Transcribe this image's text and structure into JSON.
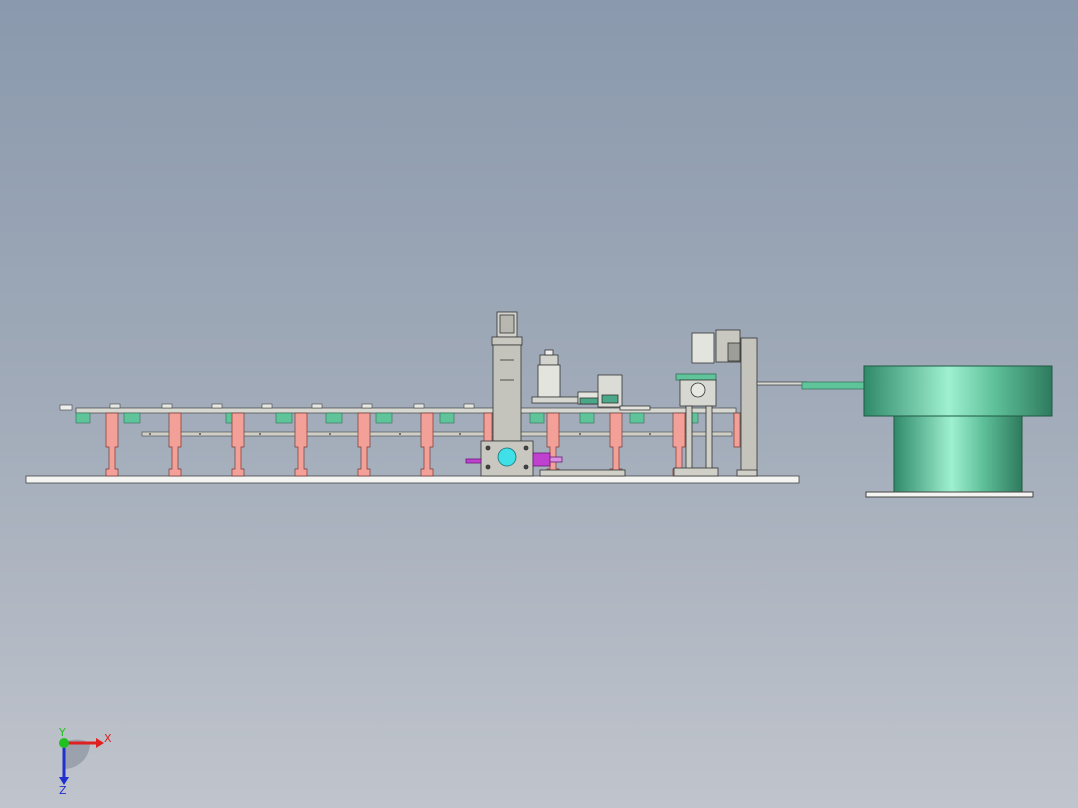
{
  "viewport": {
    "background_top": "#8a99ad",
    "background_bottom": "#c0c4cc"
  },
  "colors": {
    "frame_gray": "#c8c8c0",
    "edge": "#333333",
    "salmon_leg": "#f2a098",
    "green_block": "#5fc49a",
    "bowl_green": "#5dbf98",
    "cyan_part": "#3fe0e8",
    "magenta_part": "#c040d0"
  },
  "triad": {
    "x_label": "X",
    "y_label": "Y",
    "z_label": "Z",
    "x_color": "#e02020",
    "y_color": "#20c020",
    "z_color": "#2030d0"
  }
}
